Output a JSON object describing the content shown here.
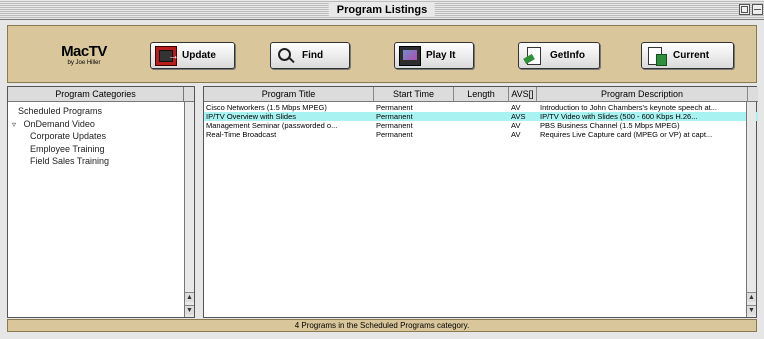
{
  "window": {
    "title": "Program Listings"
  },
  "logo": {
    "name": "MacTV",
    "subtitle": "by Joe Hiller"
  },
  "toolbar": {
    "buttons": [
      {
        "label": "Update",
        "icon": "update-icon"
      },
      {
        "label": "Find",
        "icon": "magnifier-icon"
      },
      {
        "label": "Play It",
        "icon": "play-monitor-icon"
      },
      {
        "label": "GetInfo",
        "icon": "info-document-icon"
      },
      {
        "label": "Current",
        "icon": "current-document-icon"
      }
    ]
  },
  "left_pane": {
    "header": "Program Categories",
    "items": [
      {
        "label": "Scheduled Programs",
        "level": "top"
      },
      {
        "label": "OnDemand Video",
        "level": "group",
        "disclosure": "▿"
      },
      {
        "label": "Corporate Updates",
        "level": "sub"
      },
      {
        "label": "Employee Training",
        "level": "sub"
      },
      {
        "label": "Field Sales Training",
        "level": "sub"
      }
    ]
  },
  "table": {
    "columns": [
      "Program Title",
      "Start Time",
      "Length",
      "AVS[]",
      "Program Description"
    ],
    "rows": [
      [
        "Cisco Networkers (1.5 Mbps MPEG)",
        "Permanent",
        "",
        "AV",
        "Introduction to John Chambers's keynote speech at..."
      ],
      [
        "IP/TV Overview with Slides",
        "Permanent",
        "",
        "AVS",
        "IP/TV Video with Slides (500 - 600 Kbps H.26..."
      ],
      [
        "Management Seminar (passworded o...",
        "Permanent",
        "",
        "AV",
        "PBS Business Channel (1.5 Mbps MPEG)"
      ],
      [
        "Real-Time Broadcast",
        "Permanent",
        "",
        "AV",
        "Requires Live Capture card (MPEG or VP) at capt..."
      ]
    ],
    "selected_row": 1
  },
  "status": {
    "text": "4 Programs in the Scheduled Programs category."
  },
  "colors": {
    "toolbar_bg": "#d9c79b",
    "selection": "#a8f2f2"
  }
}
